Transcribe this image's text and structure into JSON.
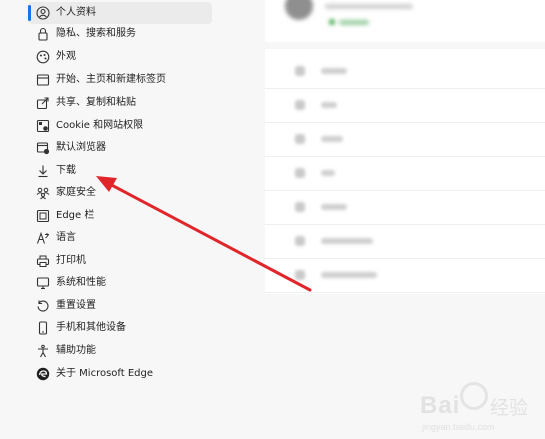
{
  "sidebar": {
    "items": [
      {
        "label": "个人资料",
        "icon": "profile-icon",
        "selected": true
      },
      {
        "label": "隐私、搜索和服务",
        "icon": "lock-icon"
      },
      {
        "label": "外观",
        "icon": "appearance-icon"
      },
      {
        "label": "开始、主页和新建标签页",
        "icon": "home-tab-icon"
      },
      {
        "label": "共享、复制和粘贴",
        "icon": "share-icon"
      },
      {
        "label": "Cookie 和网站权限",
        "icon": "cookie-icon"
      },
      {
        "label": "默认浏览器",
        "icon": "default-browser-icon"
      },
      {
        "label": "下载",
        "icon": "download-icon"
      },
      {
        "label": "家庭安全",
        "icon": "family-icon"
      },
      {
        "label": "Edge 栏",
        "icon": "edge-bar-icon"
      },
      {
        "label": "语言",
        "icon": "language-icon"
      },
      {
        "label": "打印机",
        "icon": "printer-icon"
      },
      {
        "label": "系统和性能",
        "icon": "system-icon"
      },
      {
        "label": "重置设置",
        "icon": "reset-icon"
      },
      {
        "label": "手机和其他设备",
        "icon": "phone-icon"
      },
      {
        "label": "辅助功能",
        "icon": "accessibility-icon"
      },
      {
        "label": "关于 Microsoft Edge",
        "icon": "edge-logo-icon"
      }
    ]
  },
  "colors": {
    "accent": "#1a73e8",
    "arrow": "#e0262a",
    "background": "#f7f7f7",
    "card": "#ffffff"
  },
  "watermark": {
    "brand": "Bai",
    "brand_cn": "经验",
    "url": "jingyan.baidu.com"
  }
}
